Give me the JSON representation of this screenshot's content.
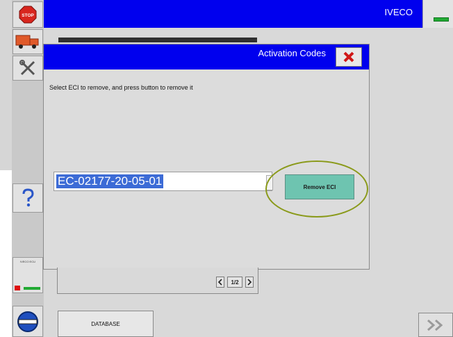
{
  "header": {
    "brand": "IVECO"
  },
  "sidebar": {
    "stop_label": "STOP",
    "ecu_label": "IVECO ECU",
    "items": [
      {
        "icon": "stop-icon"
      },
      {
        "icon": "truck-icon"
      },
      {
        "icon": "tools-icon"
      },
      {
        "icon": "help-icon"
      },
      {
        "icon": "ecu-status-icon"
      },
      {
        "icon": "disk-icon"
      }
    ]
  },
  "dialog": {
    "title": "Activation Codes",
    "instruction": "Select ECI to remove, and press button to remove it",
    "eci_value": "EC-02177-20-05-01",
    "remove_label": "Remove ECI"
  },
  "pager": {
    "page": "1/2"
  },
  "footer": {
    "database_label": "DATABASE"
  },
  "colors": {
    "accent_blue": "#0000ee",
    "remove_button": "#6ec4b0",
    "highlight_ring": "#8a9a1a",
    "stop_red": "#d8261e",
    "selection": "#3c6bd6"
  }
}
